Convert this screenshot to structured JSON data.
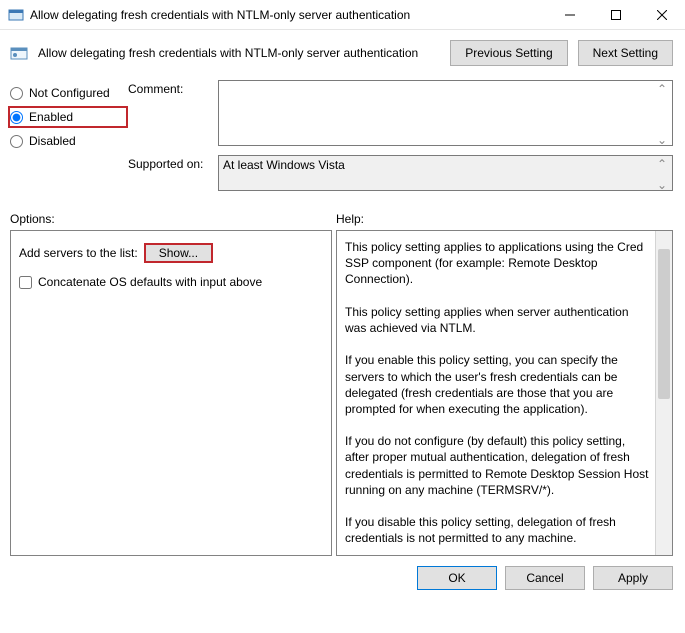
{
  "window": {
    "title": "Allow delegating fresh credentials with NTLM-only server authentication"
  },
  "header": {
    "policy_title": "Allow delegating fresh credentials with NTLM-only server authentication",
    "prev_label": "Previous Setting",
    "next_label": "Next Setting"
  },
  "state": {
    "not_configured": "Not Configured",
    "enabled": "Enabled",
    "disabled": "Disabled",
    "selected": "Enabled"
  },
  "fields": {
    "comment_label": "Comment:",
    "comment_value": "",
    "supported_label": "Supported on:",
    "supported_value": "At least Windows Vista"
  },
  "sections": {
    "options_label": "Options:",
    "help_label": "Help:"
  },
  "options": {
    "add_servers_label": "Add servers to the list:",
    "show_label": "Show...",
    "concat_label": "Concatenate OS defaults with input above",
    "concat_checked": false
  },
  "help": {
    "text": "This policy setting applies to applications using the Cred SSP component (for example: Remote Desktop Connection).\n\nThis policy setting applies when server authentication was achieved via NTLM.\n\nIf you enable this policy setting, you can specify the servers to which the user's fresh credentials can be delegated (fresh credentials are those that you are prompted for when executing the application).\n\nIf you do not configure (by default) this policy setting, after proper mutual authentication, delegation of fresh credentials is permitted to Remote Desktop Session Host running on any machine (TERMSRV/*).\n\nIf you disable this policy setting, delegation of fresh credentials is not permitted to any machine.\n\nNote: The \"Allow delegating fresh credentials with NTLM-only server authentication\" policy setting can be set to one or more"
  },
  "footer": {
    "ok": "OK",
    "cancel": "Cancel",
    "apply": "Apply"
  }
}
